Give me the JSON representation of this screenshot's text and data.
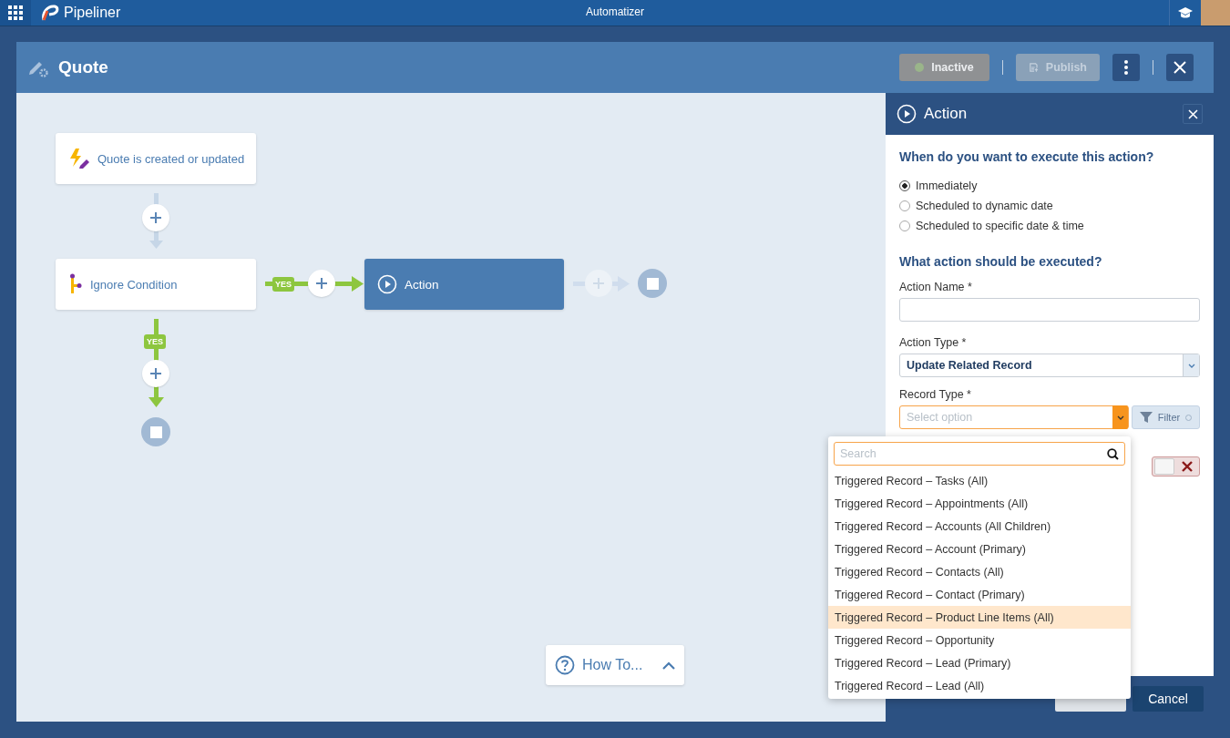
{
  "top_bar": {
    "logo": "Pipeliner",
    "title": "Automatizer"
  },
  "header": {
    "title": "Quote",
    "buttons": [
      {
        "kind": "status",
        "label": "Inactive",
        "disabled": true
      },
      {
        "kind": "publish",
        "label": "Publish",
        "disabled": true
      }
    ]
  },
  "flow": {
    "nodes": [
      {
        "kind": "trigger",
        "label": "Quote is created or updated",
        "selected": false
      },
      {
        "kind": "condition",
        "label": "Ignore Condition",
        "selected": false
      },
      {
        "kind": "action",
        "label": "Action",
        "selected": true
      }
    ],
    "branch_labels": [
      "YES",
      "YES"
    ]
  },
  "how_to": {
    "label": "How To..."
  },
  "panel": {
    "title": "Action",
    "question_1": "When do you want to execute this action?",
    "timing_options": [
      {
        "label": "Immediately",
        "selected": true
      },
      {
        "label": "Scheduled to dynamic date",
        "selected": false
      },
      {
        "label": "Scheduled to specific date & time",
        "selected": false
      }
    ],
    "question_2": "What action should be executed?",
    "action_name": {
      "label": "Action Name *"
    },
    "action_type": {
      "label": "Action Type *",
      "value": "Update Related Record"
    },
    "record_type": {
      "label": "Record Type *",
      "placeholder": "Select option",
      "open": true
    },
    "filter_button": "Filter",
    "toggle": {
      "on": false
    },
    "cancel_button": "Cancel"
  },
  "dropdown": {
    "search_placeholder": "Search",
    "options": [
      {
        "label": "Triggered Record – Tasks (All)",
        "selected": false
      },
      {
        "label": "Triggered Record – Appointments (All)",
        "selected": false
      },
      {
        "label": "Triggered Record – Accounts (All Children)",
        "selected": false
      },
      {
        "label": "Triggered Record – Account (Primary)",
        "selected": false
      },
      {
        "label": "Triggered Record – Contacts (All)",
        "selected": false
      },
      {
        "label": "Triggered Record – Contact (Primary)",
        "selected": false
      },
      {
        "label": "Triggered Record – Product Line Items (All)",
        "selected": true
      },
      {
        "label": "Triggered Record – Opportunity",
        "selected": false
      },
      {
        "label": "Triggered Record – Lead (Primary)",
        "selected": false
      },
      {
        "label": "Triggered Record – Lead (All)",
        "selected": false
      }
    ]
  }
}
